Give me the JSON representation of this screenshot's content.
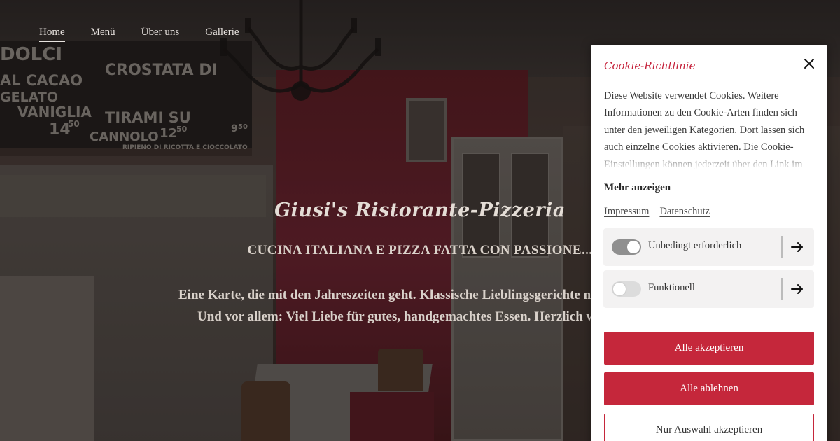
{
  "nav": {
    "items": [
      {
        "label": "Home",
        "active": true
      },
      {
        "label": "Menü",
        "active": false
      },
      {
        "label": "Über uns",
        "active": false
      },
      {
        "label": "Gallerie",
        "active": false
      }
    ]
  },
  "hero": {
    "title": "Giusi's Ristorante-Pizzeria",
    "subtitle": "CUCINA ITALIANA E PIZZA FATTA CON PASSIONE...",
    "body_line1": "Eine Karte, die mit den Jahreszeiten geht. Klassische Lieblingsgerichte neu in",
    "body_line2": "Und vor allem: Viel Liebe für gutes, handgemachtes Essen. Herzlich will",
    "chalkboard": [
      "DOLCI",
      "AL CACAO",
      "GELATO",
      "VANIGLIA",
      "14",
      "50",
      "CROSTATA DI",
      "TIRAMI SU",
      "CANNOLO",
      "12",
      "50",
      "9",
      "50",
      "RIPIENO DI RICOTTA E CIOCCOLATO"
    ]
  },
  "cookie": {
    "title": "Cookie-Richtlinie",
    "text": "Diese Website verwendet Cookies. Weitere Informationen zu den Cookie-Arten finden sich unter den jeweiligen Kategorien. Dort lassen sich auch einzelne Cookies aktivieren. Die Cookie-Einstellungen können jederzeit über den Link im",
    "more_label": "Mehr anzeigen",
    "links": {
      "imprint": "Impressum",
      "privacy": "Datenschutz"
    },
    "categories": [
      {
        "label": "Unbedingt erforderlich",
        "enabled": true
      },
      {
        "label": "Funktionell",
        "enabled": false
      }
    ],
    "buttons": {
      "accept_all": "Alle akzeptieren",
      "reject_all": "Alle ablehnen",
      "accept_selection": "Nur Auswahl akzeptieren"
    },
    "accent_color": "#c5273b"
  }
}
